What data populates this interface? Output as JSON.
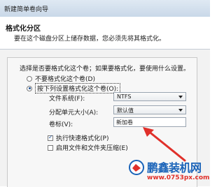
{
  "window": {
    "title": "新建简单卷向导"
  },
  "header": {
    "title": "格式化分区",
    "subtitle": "要在这个磁盘分区上储存数据，您必须先将其格式化。"
  },
  "main": {
    "prompt": "选择是否要格式化这个卷；如果要格式化，要使用什么设置。",
    "options": {
      "no_format": "不要格式化这个卷(D)",
      "format_with": "按下列设置格式化这个卷(O):"
    },
    "fields": {
      "filesystem_label": "文件系统(F):",
      "filesystem_value": "NTFS",
      "alloc_label": "分配单元大小(A):",
      "alloc_value": "默认值",
      "volume_label": "卷标(V):",
      "volume_value": "新加卷"
    },
    "checkboxes": {
      "quick_format": "执行快速格式化(P)",
      "compression": "启用文件和文件夹压缩(E)"
    }
  },
  "watermark": {
    "brand": "鹏鑫装机网",
    "url": "www.0753px.com"
  },
  "colors": {
    "accent": "#1a63b8",
    "arrow": "#e0302a"
  }
}
